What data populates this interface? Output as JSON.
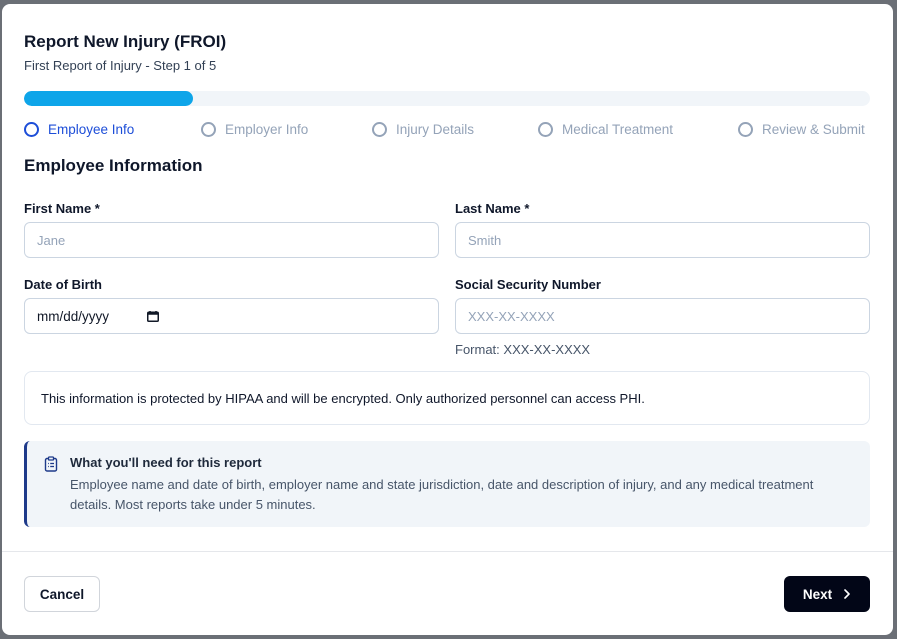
{
  "header": {
    "title": "Report New Injury (FROI)",
    "subtitle": "First Report of Injury - Step 1 of 5"
  },
  "progress": {
    "percent": 20,
    "accent_color": "#0ea5e9"
  },
  "steps": [
    {
      "label": "Employee Info",
      "active": true
    },
    {
      "label": "Employer Info",
      "active": false
    },
    {
      "label": "Injury Details",
      "active": false
    },
    {
      "label": "Medical Treatment",
      "active": false
    },
    {
      "label": "Review & Submit",
      "active": false
    }
  ],
  "section": {
    "title": "Employee Information"
  },
  "form": {
    "first_name": {
      "label": "First Name *",
      "placeholder": "Jane",
      "value": ""
    },
    "last_name": {
      "label": "Last Name *",
      "placeholder": "Smith",
      "value": ""
    },
    "dob": {
      "label": "Date of Birth",
      "placeholder": "mm/dd/yyyy",
      "icon": "calendar-icon"
    },
    "ssn": {
      "label": "Social Security Number",
      "placeholder": "XXX-XX-XXXX",
      "helper": "Format: XXX-XX-XXXX",
      "value": ""
    }
  },
  "notice": {
    "text": "This information is protected by HIPAA and will be encrypted. Only authorized personnel can access PHI."
  },
  "info_box": {
    "icon": "clipboard-icon",
    "title": "What you'll need for this report",
    "text": "Employee name and date of birth, employer name and state jurisdiction, date and description of injury, and any medical treatment details. Most reports take under 5 minutes."
  },
  "footer": {
    "cancel_label": "Cancel",
    "next_label": "Next",
    "next_icon": "chevron-right-icon"
  },
  "colors": {
    "active_step": "#1d4ed8",
    "inactive_step": "#94a3b8",
    "primary_button": "#020617",
    "info_border": "#1e3a8a"
  }
}
